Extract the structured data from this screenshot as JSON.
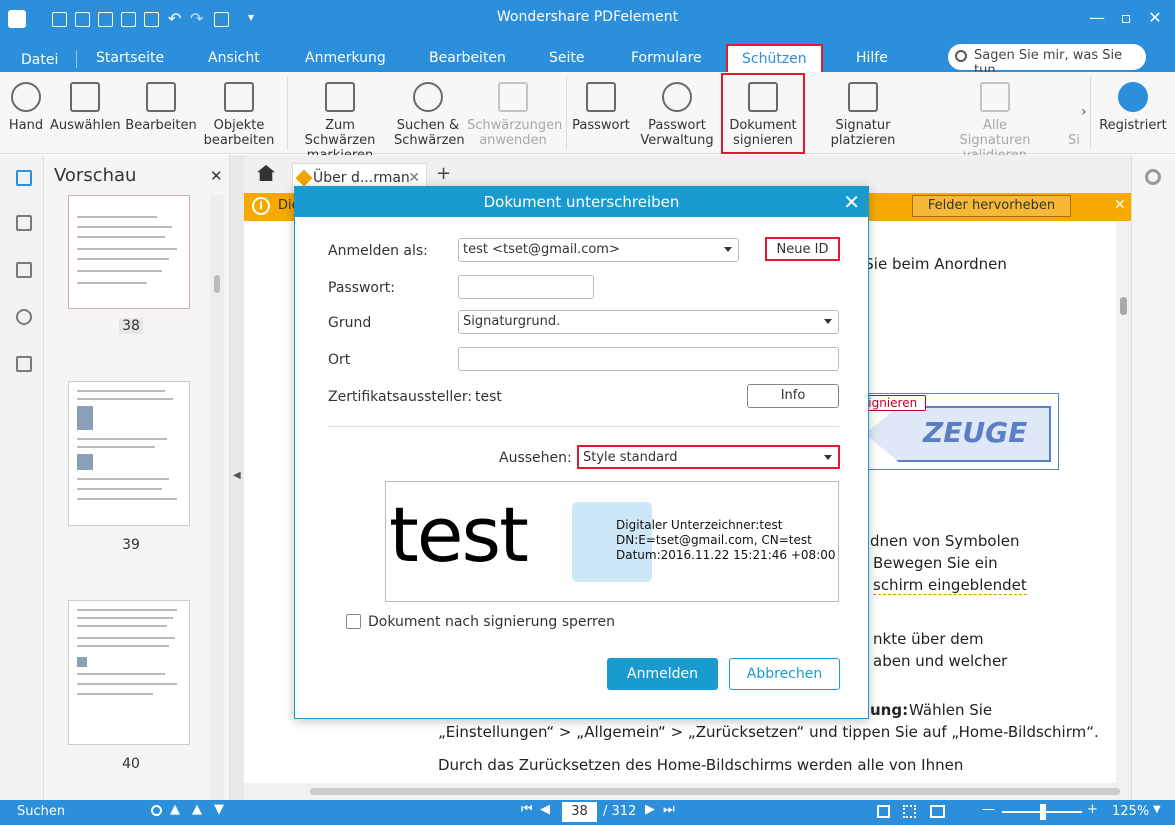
{
  "app": {
    "title": "Wondershare PDFelement",
    "accent": "#2b8fdc",
    "highlight_red": "#e0192c"
  },
  "menu": {
    "tabs": [
      "Datei",
      "Startseite",
      "Ansicht",
      "Anmerkung",
      "Bearbeiten",
      "Seite",
      "Formulare",
      "Schützen",
      "Hilfe"
    ],
    "active_tab": "Schützen",
    "search_placeholder": "Sagen Sie mir, was Sie tun"
  },
  "ribbon": {
    "hand": "Hand",
    "select": "Auswählen",
    "edit": "Bearbeiten",
    "edit_objects_1": "Objekte",
    "edit_objects_2": "bearbeiten",
    "redact_1": "Zum Schwärzen",
    "redact_2": "markieren",
    "search_redact_1": "Suchen &",
    "search_redact_2": "Schwärzen",
    "apply_redact_1": "Schwärzungen",
    "apply_redact_2": "anwenden",
    "password": "Passwort",
    "pw_manage_1": "Passwort",
    "pw_manage_2": "Verwaltung",
    "sign_doc_1": "Dokument",
    "sign_doc_2": "signieren",
    "place_sig": "Signatur platzieren",
    "validate_all_1": "Alle",
    "validate_all_2": "Signaturen validieren",
    "more_cut": "Si",
    "registered": "Registriert"
  },
  "sidebar": {
    "title": "Vorschau",
    "pages": [
      "38",
      "39",
      "40"
    ]
  },
  "document_tab": {
    "label": "Über d...rman"
  },
  "notice": {
    "text": "Die",
    "button": "Felder hervorheben"
  },
  "document": {
    "lines": [
      "n Sie beim Anordnen",
      "dnen von Symbolen",
      "Bewegen Sie ein",
      "schirm eingeblendet",
      "nkte über dem",
      "aben und welcher",
      "ung:",
      "Wählen Sie",
      "„Einstellungen“ > „Allgemein“ > „Zurücksetzen“ und tippen Sie auf „Home-Bildschirm“.",
      "Durch das Zurücksetzen des Home-Bildschirms werden alle von Ihnen"
    ],
    "stamp_label": "signieren",
    "stamp_text": "ZEUGE"
  },
  "dialog": {
    "title": "Dokument unterschreiben",
    "login_as_label": "Anmelden als:",
    "login_as_value": "test <tset@gmail.com>",
    "new_id": "Neue ID",
    "password_label": "Passwort:",
    "reason_label": "Grund",
    "reason_value": "Signaturgrund.",
    "location_label": "Ort",
    "issuer_label": "Zertifikatsaussteller:",
    "issuer_value": "test",
    "info_button": "Info",
    "appearance_label": "Aussehen:",
    "appearance_value": "Style standard",
    "preview_name": "test",
    "preview_line1": "Digitaler Unterzeichner:test",
    "preview_line2": "DN:E=tset@gmail.com, CN=test",
    "preview_line3": "Datum:2016.11.22 15:21:46 +08:00",
    "lock_checkbox": "Dokument nach signierung sperren",
    "ok": "Anmelden",
    "cancel": "Abbrechen"
  },
  "status": {
    "search": "Suchen",
    "page_current": "38",
    "page_total": "/ 312",
    "zoom": "125%"
  }
}
